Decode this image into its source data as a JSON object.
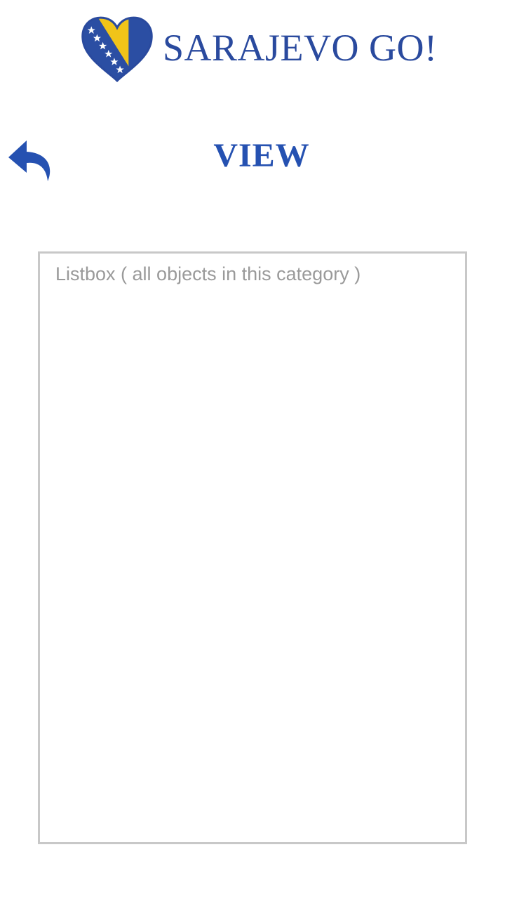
{
  "header": {
    "logo_text": "SARAJEVO GO!",
    "brand_color": "#2a4a9e",
    "logo_icon": "heart-flag-icon"
  },
  "nav": {
    "back_icon": "reply-back-arrow-icon",
    "title": "VIEW",
    "title_color": "#2551b1"
  },
  "listbox": {
    "placeholder": "Listbox ( all objects in this category )",
    "border_color": "#c8c8c8",
    "text_color": "#9a9a9a",
    "items": []
  }
}
